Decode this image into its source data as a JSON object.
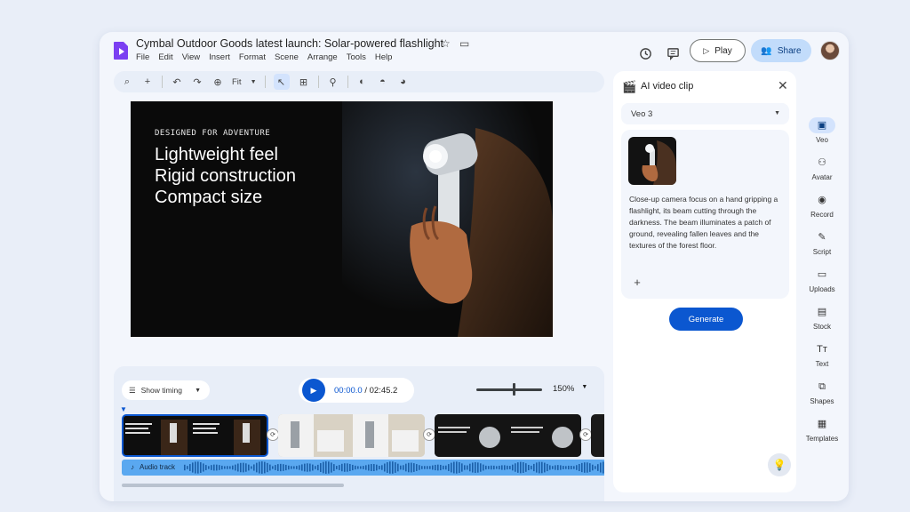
{
  "colors": {
    "accent": "#0b57d0",
    "share_bg": "#c2dcfb",
    "audio": "#5aa8f0",
    "app_logo": "#7b3ff2"
  },
  "header": {
    "title": "Cymbal Outdoor Goods latest launch: Solar-powered flashlight",
    "menu": [
      "File",
      "Edit",
      "View",
      "Insert",
      "Format",
      "Scene",
      "Arrange",
      "Tools",
      "Help"
    ],
    "play_label": "Play",
    "share_label": "Share",
    "icons": [
      "history-icon",
      "comment-icon",
      "star-icon",
      "folder-move-icon"
    ]
  },
  "toolbar": {
    "zoom_label": "Fit"
  },
  "slide": {
    "kicker": "DESIGNED FOR ADVENTURE",
    "lines": [
      "Lightweight feel",
      "Rigid construction",
      "Compact size"
    ]
  },
  "panel": {
    "title": "AI video clip",
    "model": "Veo 3",
    "prompt": "Close-up camera focus on a hand gripping a flashlight, its beam cutting through the darkness. The beam illuminates a patch of ground, revealing fallen leaves and the textures of the forest floor.",
    "generate_label": "Generate"
  },
  "rail": [
    "Veo",
    "Avatar",
    "Record",
    "Script",
    "Uploads",
    "Stock",
    "Text",
    "Shapes",
    "Templates"
  ],
  "timeline": {
    "timing_label": "Show timing",
    "current_time": "00:00.0",
    "total_time": "02:45.2",
    "zoom": "150%",
    "audio_label": "Audio track"
  }
}
